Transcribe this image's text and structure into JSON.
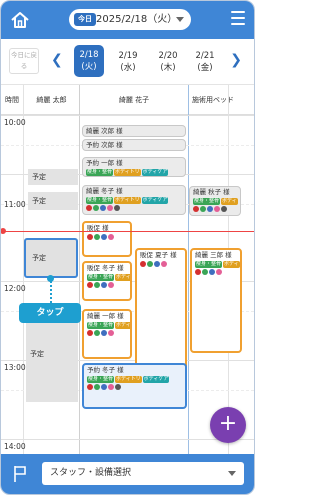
{
  "header": {
    "today_badge": "今日",
    "date": "2025/2/18（火）"
  },
  "datebar": {
    "back_today": "今日に戻る",
    "days": [
      {
        "date": "2/18",
        "weekday": "(火)"
      },
      {
        "date": "2/19",
        "weekday": "(水)"
      },
      {
        "date": "2/20",
        "weekday": "(木)"
      },
      {
        "date": "2/21",
        "weekday": "(金)"
      }
    ]
  },
  "columns": {
    "time": "時間",
    "staff1": "綺麗 太郎",
    "staff2": "綺麗 花子",
    "equipment": "施術用ベッド"
  },
  "times": [
    "10:00",
    "11:00",
    "12:00",
    "13:00",
    "14:00"
  ],
  "blocks": {
    "yotei1": "予定",
    "yotei2": "予定",
    "yotei_selected": "予定",
    "yotei3": "予定"
  },
  "tap_label": "タップ",
  "appointments": {
    "a1": "綺麗 次郎 様",
    "a2": "予約 次郎 様",
    "a3": "予約 一郎 様",
    "a4": "綺麗 冬子 様",
    "a5": "綺麗 秋子 様",
    "a6": "販促 様",
    "a7": "販促 冬子 様",
    "a8": "販促 夏子 様",
    "a9": "綺麗 三郎 様",
    "a10": "綺麗 一郎 様",
    "a11": "予約 冬子 様",
    "a12": "綺麗 秋子 様"
  },
  "tags": {
    "t1": "痩身・整骨",
    "t2": "ボディトリ",
    "t3": "ボディケア",
    "t4": "ボディ"
  },
  "fab": "+",
  "bottom": {
    "staff_select": "スタッフ・設備選択"
  },
  "colors": {
    "primary": "#3f86d6",
    "accent_fab": "#7a3fb0",
    "now_line": "#e44444",
    "tap": "#1e9fd0",
    "appt_border_orange": "#f0a030"
  }
}
